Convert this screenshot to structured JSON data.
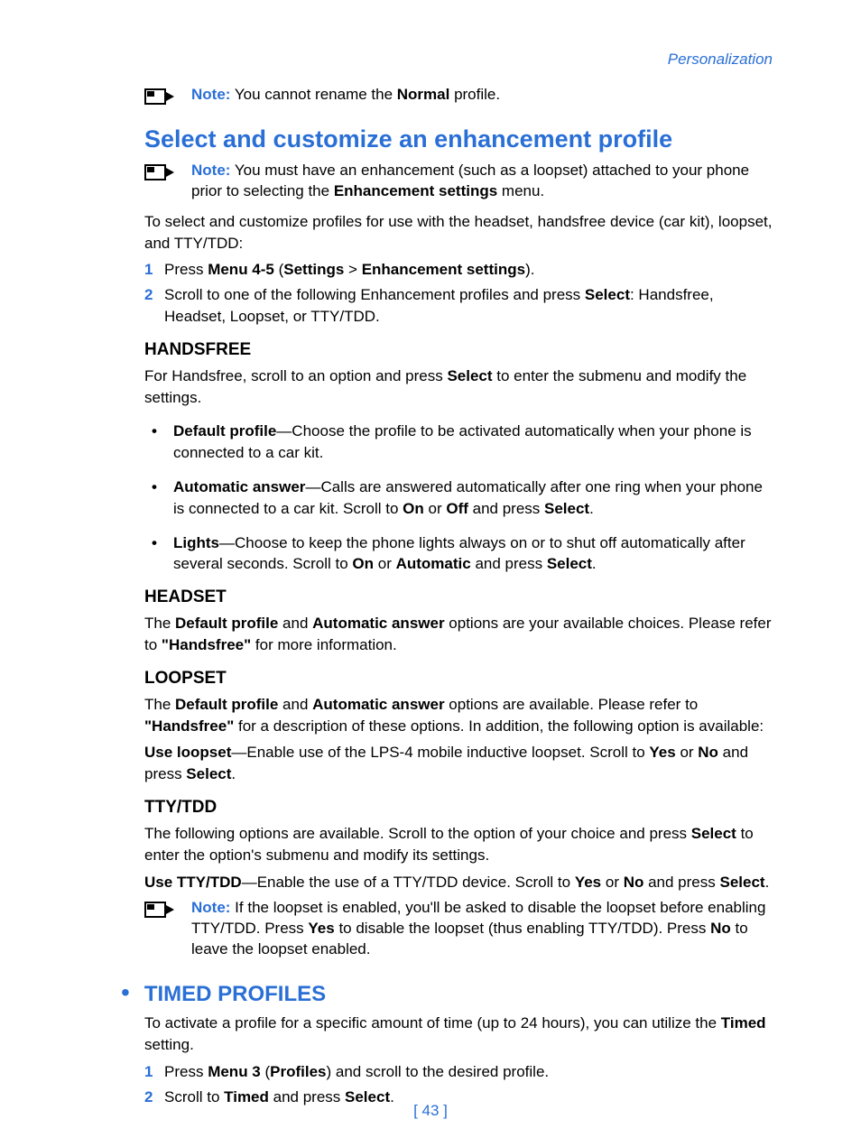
{
  "header": {
    "section": "Personalization"
  },
  "noteTop": {
    "prefix": "Note:",
    "textBefore": " You cannot rename the ",
    "bold": "Normal",
    "textAfter": " profile."
  },
  "h1": "Select and customize an enhancement profile",
  "noteEnhance": {
    "prefix": "Note:",
    "t1": " You must have an enhancement (such as a loopset) attached to your phone prior to selecting the ",
    "b1": "Enhancement settings",
    "t2": " menu."
  },
  "intro": "To select and customize profiles for use with the headset, handsfree device (car kit), loopset, and TTY/TDD:",
  "steps1": [
    {
      "n": "1",
      "t1": "Press ",
      "b1": "Menu 4-5",
      "t2": " (",
      "b2": "Settings",
      "t3": " > ",
      "b3": "Enhancement settings",
      "t4": ")."
    },
    {
      "n": "2",
      "t1": "Scroll to one of the following Enhancement profiles and press ",
      "b1": "Select",
      "t2": ": Handsfree, Headset, Loopset, or TTY/TDD."
    }
  ],
  "handsfree": {
    "title": "HANDSFREE",
    "intro_t1": "For Handsfree, scroll to an option and press ",
    "intro_b1": "Select",
    "intro_t2": " to enter the submenu and modify the settings.",
    "items": [
      {
        "b": "Default profile",
        "t": "—Choose the profile to be activated automatically when your phone is connected to a car kit."
      },
      {
        "b": "Automatic answer",
        "t1": "—Calls are answered automatically after one ring when your phone is connected to a car kit. Scroll to ",
        "b1": "On",
        "t2": " or ",
        "b2": "Off",
        "t3": " and press ",
        "b3": "Select",
        "t4": "."
      },
      {
        "b": "Lights",
        "t1": "—Choose to keep the phone lights always on or to shut off automatically after several seconds. Scroll to ",
        "b1": "On",
        "t2": " or ",
        "b2": "Automatic",
        "t3": " and press ",
        "b3": "Select",
        "t4": "."
      }
    ]
  },
  "headset": {
    "title": "HEADSET",
    "t1": "The ",
    "b1": "Default profile",
    "t2": " and ",
    "b2": "Automatic answer",
    "t3": " options are your available choices. Please refer to ",
    "b3": "\"Handsfree\"",
    "t4": " for more information."
  },
  "loopset": {
    "title": "LOOPSET",
    "p1_t1": "The ",
    "p1_b1": "Default profile",
    "p1_t2": " and ",
    "p1_b2": "Automatic answer",
    "p1_t3": " options are available. Please refer to ",
    "p1_b3": "\"Handsfree\"",
    "p1_t4": " for a description of these options. In addition, the following option is available:",
    "p2_b1": "Use loopset",
    "p2_t1": "—Enable use of the LPS-4 mobile inductive loopset. Scroll to ",
    "p2_b2": "Yes",
    "p2_t2": " or ",
    "p2_b3": "No",
    "p2_t3": " and press ",
    "p2_b4": "Select",
    "p2_t4": "."
  },
  "tty": {
    "title": "TTY/TDD",
    "p1_t1": "The following options are available. Scroll to the option of your choice and press ",
    "p1_b1": "Select",
    "p1_t2": " to enter the option's submenu and modify its settings.",
    "p2_b1": "Use TTY/TDD",
    "p2_t1": "—Enable the use of a TTY/TDD device. Scroll to ",
    "p2_b2": "Yes",
    "p2_t2": " or ",
    "p2_b3": "No",
    "p2_t3": " and press ",
    "p2_b4": "Select",
    "p2_t4": "."
  },
  "noteTty": {
    "prefix": "Note:",
    "t1": " If the loopset is enabled, you'll be asked to disable the loopset before enabling TTY/TDD. Press ",
    "b1": "Yes",
    "t2": " to disable the loopset (thus enabling TTY/TDD). Press ",
    "b2": "No",
    "t3": " to leave the loopset enabled."
  },
  "timed": {
    "title": "TIMED PROFILES",
    "intro_t1": "To activate a profile for a specific amount of time (up to 24 hours), you can utilize the ",
    "intro_b1": "Timed",
    "intro_t2": " setting.",
    "steps": [
      {
        "n": "1",
        "t1": "Press ",
        "b1": "Menu 3",
        "t2": " (",
        "b2": "Profiles",
        "t3": ") and scroll to the desired profile."
      },
      {
        "n": "2",
        "t1": "Scroll to ",
        "b1": "Timed",
        "t2": " and press ",
        "b2": "Select",
        "t3": "."
      }
    ]
  },
  "pageNumber": "[ 43 ]"
}
